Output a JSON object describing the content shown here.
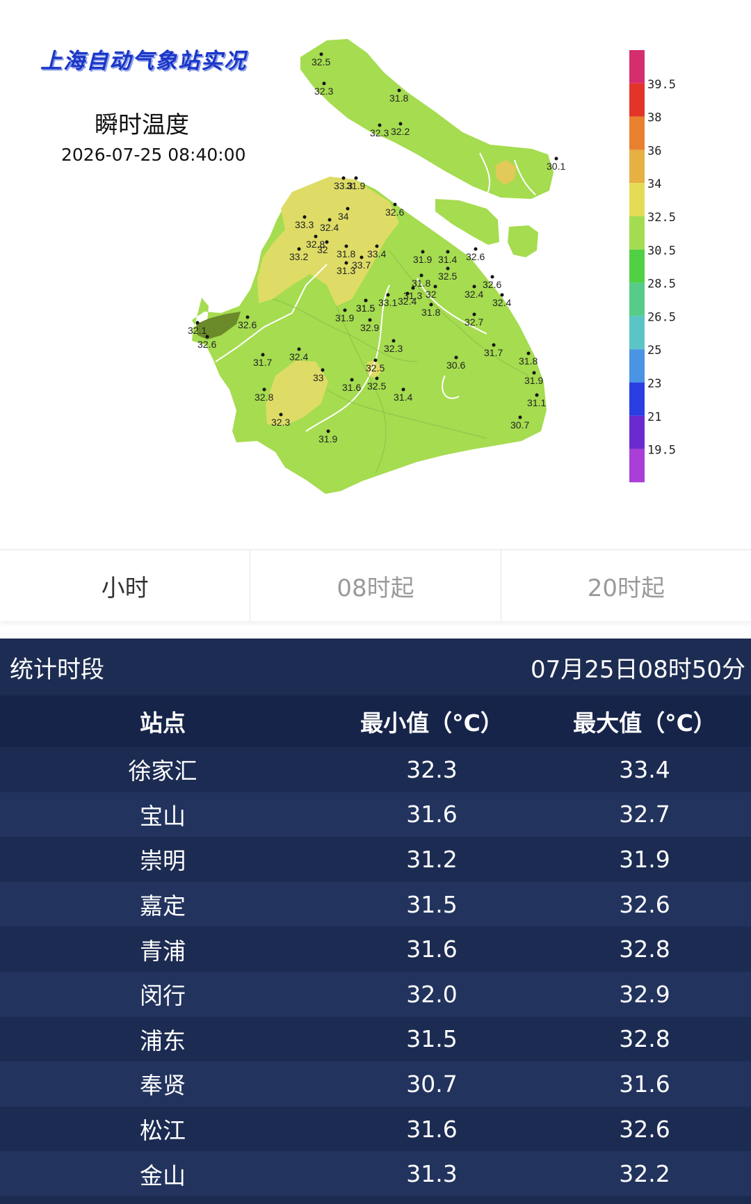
{
  "map": {
    "brand": "上海自动气象站实况",
    "title": "瞬时温度",
    "timestamp": "2026-07-25 08:40:00",
    "colors": {
      "land_main": "#a5dc50",
      "land_warm": "#dedc66",
      "land_hot": "#e2c95a",
      "river": "#ffffff"
    },
    "legend": {
      "labels": [
        "39.5",
        "38",
        "36",
        "34",
        "32.5",
        "30.5",
        "28.5",
        "26.5",
        "25",
        "23",
        "21",
        "19.5"
      ],
      "colors": [
        "#d52e6e",
        "#e3342a",
        "#e9802f",
        "#e6b042",
        "#e4dc57",
        "#a3dc51",
        "#51cf45",
        "#57cc8a",
        "#5bc5c6",
        "#4a94e3",
        "#2b3ee2",
        "#6a2ad0",
        "#a93fd6"
      ]
    },
    "stations": [
      {
        "v": "32.5"
      },
      {
        "v": "32.3"
      },
      {
        "v": "31.8"
      },
      {
        "v": "32.3"
      },
      {
        "v": "32.2"
      },
      {
        "v": "30.1"
      },
      {
        "v": "33.3"
      },
      {
        "v": "31.9"
      },
      {
        "v": "34"
      },
      {
        "v": "32.6"
      },
      {
        "v": "33.3"
      },
      {
        "v": "32.4"
      },
      {
        "v": "32.8"
      },
      {
        "v": "32"
      },
      {
        "v": "33.2"
      },
      {
        "v": "31.8"
      },
      {
        "v": "31.3"
      },
      {
        "v": "33.7"
      },
      {
        "v": "33.4"
      },
      {
        "v": "31.9"
      },
      {
        "v": "32.6"
      },
      {
        "v": "31.4"
      },
      {
        "v": "32.5"
      },
      {
        "v": "31.8"
      },
      {
        "v": "32"
      },
      {
        "v": "31.3"
      },
      {
        "v": "32.4"
      },
      {
        "v": "32.6"
      },
      {
        "v": "32.4"
      },
      {
        "v": "31.5"
      },
      {
        "v": "31.5"
      },
      {
        "v": "33.1"
      },
      {
        "v": "32.4"
      },
      {
        "v": "31.8"
      },
      {
        "v": "32.7"
      },
      {
        "v": "31.9"
      },
      {
        "v": "32.9"
      },
      {
        "v": "32.1"
      },
      {
        "v": "32.6"
      },
      {
        "v": "32.6"
      },
      {
        "v": "32.3"
      },
      {
        "v": "31.7"
      },
      {
        "v": "32.4"
      },
      {
        "v": "33"
      },
      {
        "v": "32.5"
      },
      {
        "v": "31.6"
      },
      {
        "v": "32.5"
      },
      {
        "v": "30.6"
      },
      {
        "v": "31.7"
      },
      {
        "v": "31.8"
      },
      {
        "v": "31.9"
      },
      {
        "v": "32.8"
      },
      {
        "v": "31.4"
      },
      {
        "v": "31.1"
      },
      {
        "v": "30.7"
      },
      {
        "v": "32.3"
      },
      {
        "v": "31.9"
      }
    ]
  },
  "tabs": [
    {
      "label": "小时",
      "active": true
    },
    {
      "label": "08时起",
      "active": false
    },
    {
      "label": "20时起",
      "active": false
    }
  ],
  "stats": {
    "period_label": "统计时段",
    "period_value": "07月25日08时50分",
    "columns": [
      "站点",
      "最小值（°C）",
      "最大值（°C）"
    ],
    "rows": [
      [
        "徐家汇",
        "32.3",
        "33.4"
      ],
      [
        "宝山",
        "31.6",
        "32.7"
      ],
      [
        "崇明",
        "31.2",
        "31.9"
      ],
      [
        "嘉定",
        "31.5",
        "32.6"
      ],
      [
        "青浦",
        "31.6",
        "32.8"
      ],
      [
        "闵行",
        "32.0",
        "32.9"
      ],
      [
        "浦东",
        "31.5",
        "32.8"
      ],
      [
        "奉贤",
        "30.7",
        "31.6"
      ],
      [
        "松江",
        "31.6",
        "32.6"
      ],
      [
        "金山",
        "31.3",
        "32.2"
      ]
    ]
  }
}
